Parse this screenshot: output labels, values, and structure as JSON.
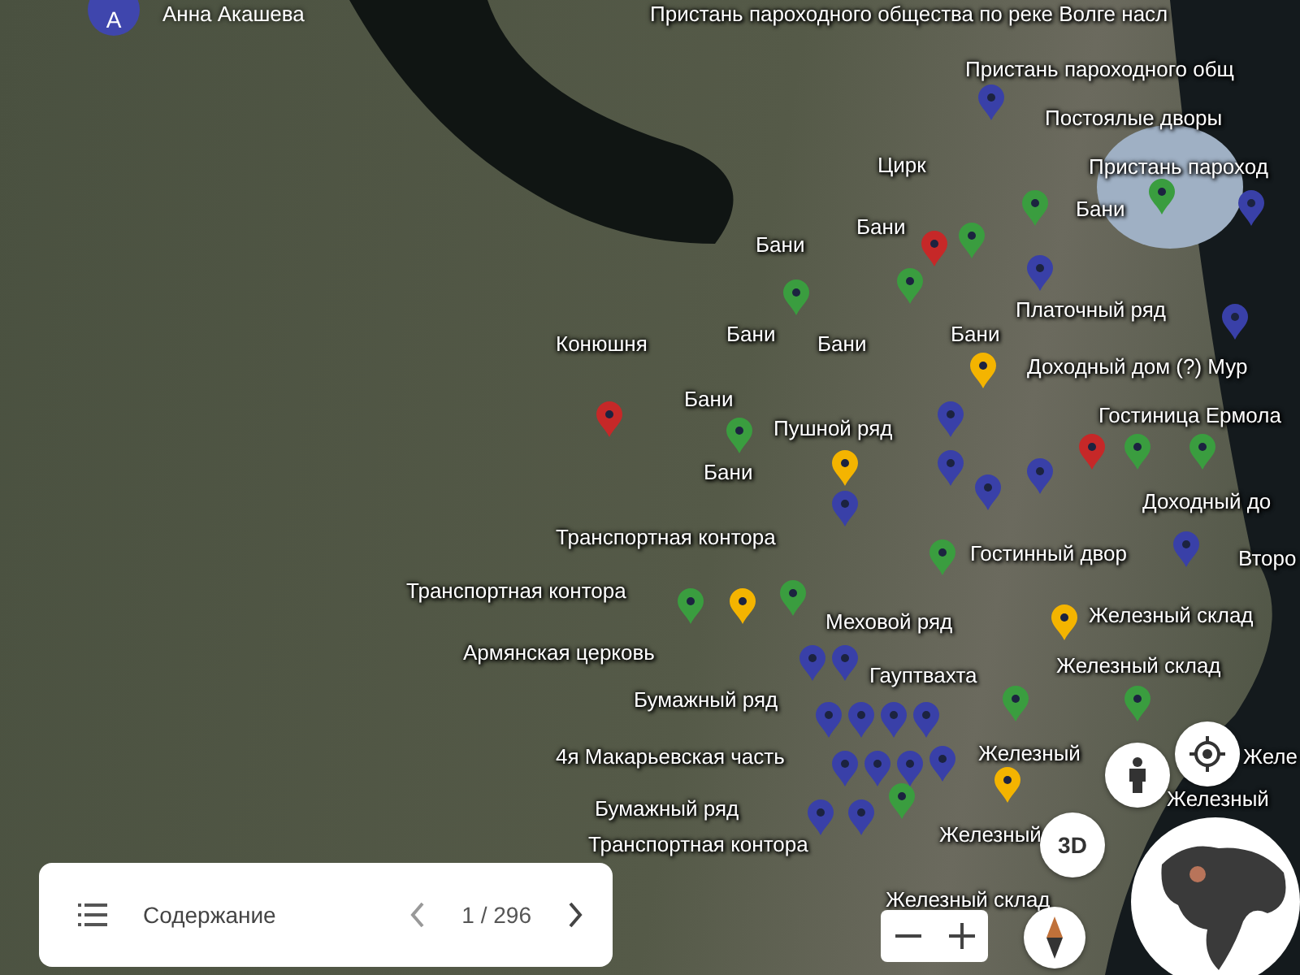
{
  "user": {
    "initial": "A",
    "name": "Анна Акашева"
  },
  "labels": [
    "Пристань пароходного общества по реке Волге насл",
    "Пристань пароходного общ",
    "Постоялые дворы",
    "Цирк",
    "Пристань пароход",
    "Бани",
    "Бани",
    "Бани",
    "Платочный ряд",
    "Конюшня",
    "Бани",
    "Бани",
    "Бани",
    "Доходный дом (?) Мур",
    "Бани",
    "Пушной ряд",
    "Гостиница Ермола",
    "Бани",
    "Доходный до",
    "Транспортная контора",
    "Гостинный двор",
    "Второ",
    "Транспортная контора",
    "Меховой ряд",
    "Железный склад",
    "Армянская церковь",
    "Гауптвахта",
    "Железный склад",
    "Бумажный ряд",
    "4я Макарьевская часть",
    "Железный",
    "Желе",
    "Бумажный ряд",
    "Железный",
    "Железный",
    "Транспортная контора",
    "Железный склад"
  ],
  "pins": [
    {
      "color": "#c62828"
    },
    {
      "color": "#c62828"
    },
    {
      "color": "#c62828"
    },
    {
      "color": "#f4b400"
    },
    {
      "color": "#f4b400"
    },
    {
      "color": "#f4b400"
    },
    {
      "color": "#f4b400"
    },
    {
      "color": "#f4b400"
    },
    {
      "color": "#3a9d3f"
    },
    {
      "color": "#3a9d3f"
    },
    {
      "color": "#3a9d3f"
    },
    {
      "color": "#3a9d3f"
    },
    {
      "color": "#3a9d3f"
    },
    {
      "color": "#3a9d3f"
    },
    {
      "color": "#3a9d3f"
    },
    {
      "color": "#3a9d3f"
    },
    {
      "color": "#3a9d3f"
    },
    {
      "color": "#3a9d3f"
    },
    {
      "color": "#3a9d3f"
    },
    {
      "color": "#3a9d3f"
    },
    {
      "color": "#3a9d3f"
    },
    {
      "color": "#3a9d3f"
    },
    {
      "color": "#3940a8"
    },
    {
      "color": "#3940a8"
    },
    {
      "color": "#3940a8"
    },
    {
      "color": "#3940a8"
    },
    {
      "color": "#3940a8"
    },
    {
      "color": "#3940a8"
    },
    {
      "color": "#3940a8"
    },
    {
      "color": "#3940a8"
    },
    {
      "color": "#3940a8"
    },
    {
      "color": "#3940a8"
    },
    {
      "color": "#3940a8"
    },
    {
      "color": "#3940a8"
    },
    {
      "color": "#3940a8"
    },
    {
      "color": "#3940a8"
    },
    {
      "color": "#3940a8"
    },
    {
      "color": "#3940a8"
    },
    {
      "color": "#3940a8"
    },
    {
      "color": "#3940a8"
    },
    {
      "color": "#3940a8"
    },
    {
      "color": "#3940a8"
    },
    {
      "color": "#3940a8"
    },
    {
      "color": "#3940a8"
    }
  ],
  "contents": {
    "title": "Содержание",
    "counter": "1 / 296"
  },
  "three_d": "3D"
}
